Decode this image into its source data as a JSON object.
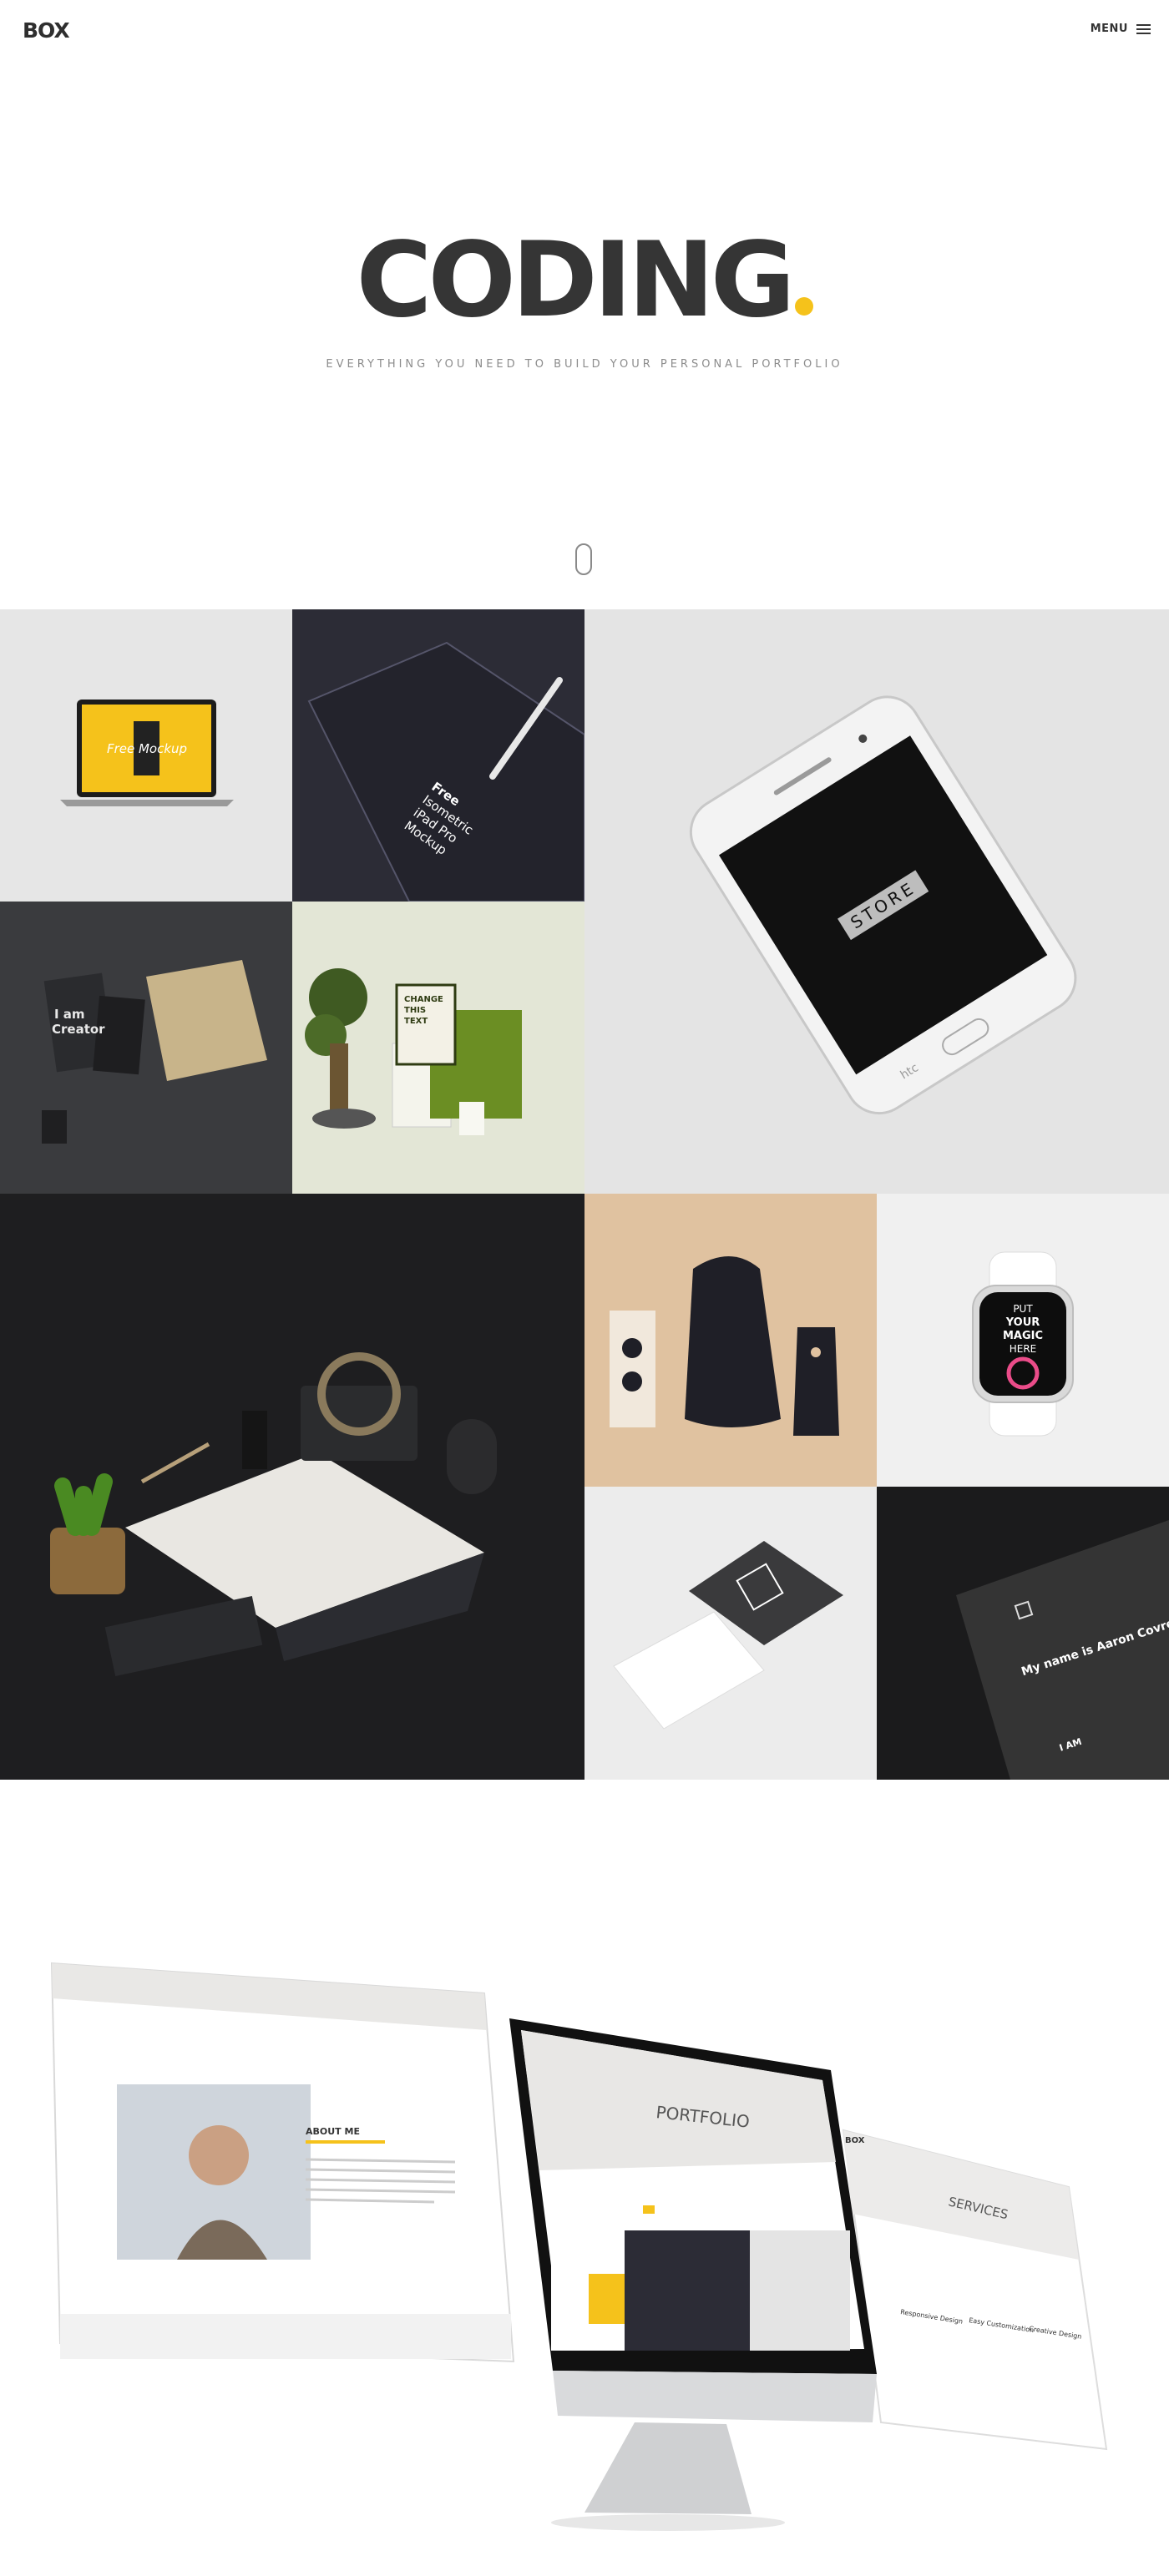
{
  "header": {
    "logo": "BOX",
    "menu_label": "MENU"
  },
  "hero": {
    "title": "CODING",
    "subtitle": "EVERYTHING YOU NEED TO BUILD YOUR PERSONAL PORTFOLIO",
    "accent_color": "#f5c21b"
  },
  "portfolio": {
    "laptop_screen_text": "Free Mockup",
    "ipad_text": [
      "Free",
      "Isometric",
      "iPad Pro",
      "Mockup"
    ],
    "phone_screen_text": "STORE",
    "phone_brand": "htc",
    "stationery_text": [
      "I am",
      "Creator"
    ],
    "branding_card_text": [
      "CHANGE",
      "THIS",
      "TEXT"
    ],
    "watch_text": [
      "PUT",
      "YOUR",
      "MAGIC",
      "HERE"
    ],
    "card_text": "My name is Aaron Covre and I am always search to develop my skills as designer and problem",
    "card_footer": "I AM"
  },
  "showcase": {
    "about_title": "ABOUT ME",
    "portfolio_title": "PORTFOLIO",
    "services_title": "SERVICES",
    "services_items": [
      "Responsive Design",
      "Easy Customization",
      "Creative Design"
    ],
    "screen_mini_logo": "BOX"
  }
}
